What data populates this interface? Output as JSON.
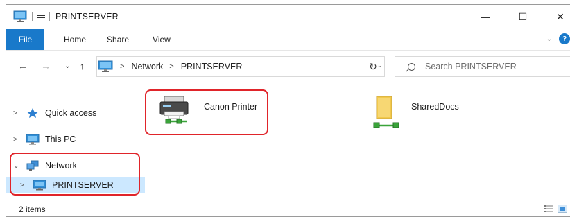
{
  "window": {
    "title": "PRINTSERVER",
    "controls": {
      "minimize": "—",
      "maximize": "☐",
      "close": "✕"
    }
  },
  "ribbon": {
    "file": "File",
    "tabs": [
      "Home",
      "Share",
      "View"
    ],
    "expand_glyph": "⌄",
    "help_glyph": "?"
  },
  "address": {
    "back_glyph": "←",
    "forward_glyph": "→",
    "recent_glyph": "⌄",
    "up_glyph": "↑",
    "crumbs": [
      "Network",
      "PRINTSERVER"
    ],
    "crumb_separator": ">",
    "dropdown_glyph": "⌄",
    "refresh_glyph": "↻",
    "search_placeholder": "Search PRINTSERVER"
  },
  "nav": {
    "items": [
      {
        "label": "Quick access",
        "chevron": ">"
      },
      {
        "label": "This PC",
        "chevron": ">"
      },
      {
        "label": "Network",
        "chevron": "⌄"
      },
      {
        "label": "PRINTSERVER",
        "chevron": ">"
      }
    ]
  },
  "content": {
    "items": [
      {
        "label": "Canon Printer",
        "icon": "network-printer-icon"
      },
      {
        "label": "SharedDocs",
        "icon": "shared-folder-icon"
      }
    ]
  },
  "status": {
    "count": "2 items"
  },
  "colors": {
    "accent": "#1979ca",
    "highlight": "#e0242a",
    "selection": "#cce8ff"
  }
}
